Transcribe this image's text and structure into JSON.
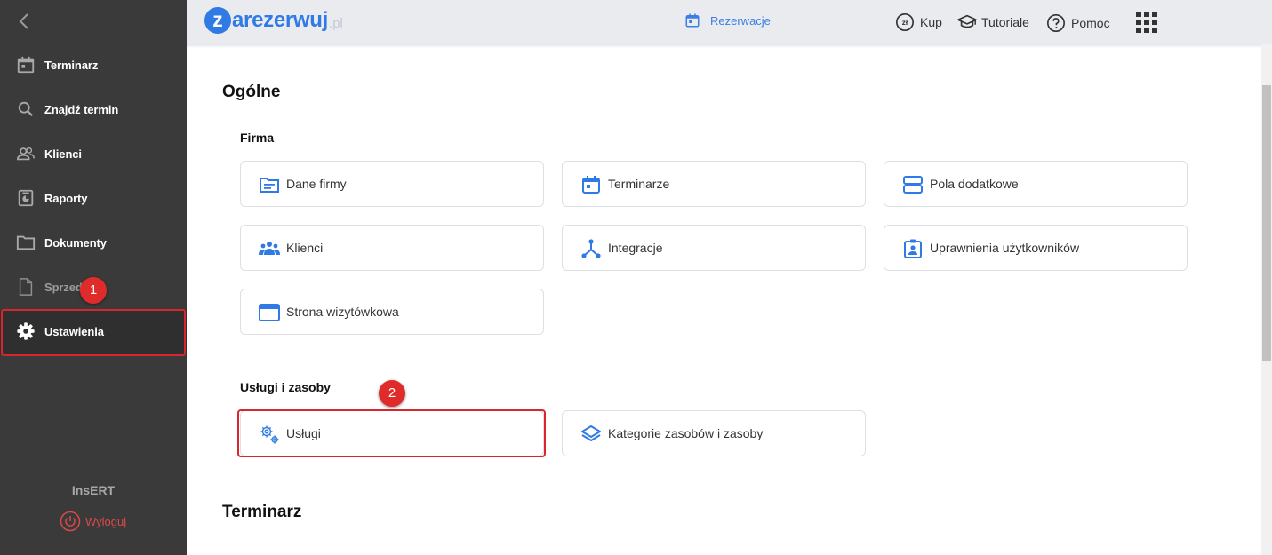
{
  "sidebar": {
    "items": [
      {
        "label": "Terminarz"
      },
      {
        "label": "Znajdź termin"
      },
      {
        "label": "Klienci"
      },
      {
        "label": "Raporty"
      },
      {
        "label": "Dokumenty"
      },
      {
        "label": "Sprzedaż"
      },
      {
        "label": "Ustawienia"
      }
    ],
    "brand": "InsERT",
    "logout_label": "Wyloguj"
  },
  "badges": {
    "first": "1",
    "second": "2"
  },
  "topbar": {
    "logo_letter": "z",
    "logo_text": "arezerwuj",
    "logo_suffix": ".pl",
    "reservations_label": "Rezerwacje",
    "buy_label": "Kup",
    "tutorials_label": "Tutoriale",
    "help_label": "Pomoc"
  },
  "main": {
    "general_title": "Ogólne",
    "company_section": "Firma",
    "company_cards": [
      {
        "label": "Dane firmy",
        "icon": "company-data-icon"
      },
      {
        "label": "Terminarze",
        "icon": "calendar-icon"
      },
      {
        "label": "Pola dodatkowe",
        "icon": "extra-fields-icon"
      },
      {
        "label": "Klienci",
        "icon": "clients-icon"
      },
      {
        "label": "Integracje",
        "icon": "integrations-icon"
      },
      {
        "label": "Uprawnienia użytkowników",
        "icon": "user-permissions-icon"
      },
      {
        "label": "Strona wizytówkowa",
        "icon": "website-icon"
      }
    ],
    "services_section": "Usługi i zasoby",
    "services_cards": [
      {
        "label": "Usługi",
        "icon": "services-gears-icon"
      },
      {
        "label": "Kategorie zasobów i zasoby",
        "icon": "layers-icon"
      }
    ],
    "scheduler_title": "Terminarz"
  },
  "colors": {
    "sidebar_bg": "#3a3a3a",
    "accent": "#2f7ae5",
    "highlight": "#d9262c"
  }
}
